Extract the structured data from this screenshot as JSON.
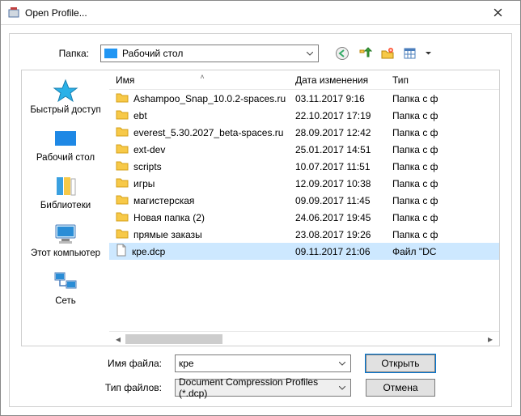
{
  "window": {
    "title": "Open Profile..."
  },
  "folder": {
    "label": "Папка:",
    "current": "Рабочий стол"
  },
  "sidebar": {
    "items": [
      {
        "label": "Быстрый доступ"
      },
      {
        "label": "Рабочий стол"
      },
      {
        "label": "Библиотеки"
      },
      {
        "label": "Этот компьютер"
      },
      {
        "label": "Сеть"
      }
    ]
  },
  "columns": {
    "name": "Имя",
    "date": "Дата изменения",
    "type": "Тип"
  },
  "files": [
    {
      "name": "Ashampoo_Snap_10.0.2-spaces.ru",
      "date": "03.11.2017 9:16",
      "type": "Папка с ф",
      "kind": "folder"
    },
    {
      "name": "ebt",
      "date": "22.10.2017 17:19",
      "type": "Папка с ф",
      "kind": "folder"
    },
    {
      "name": "everest_5.30.2027_beta-spaces.ru",
      "date": "28.09.2017 12:42",
      "type": "Папка с ф",
      "kind": "folder"
    },
    {
      "name": "ext-dev",
      "date": "25.01.2017 14:51",
      "type": "Папка с ф",
      "kind": "folder"
    },
    {
      "name": "scripts",
      "date": "10.07.2017 11:51",
      "type": "Папка с ф",
      "kind": "folder"
    },
    {
      "name": "игры",
      "date": "12.09.2017 10:38",
      "type": "Папка с ф",
      "kind": "folder"
    },
    {
      "name": "магистерская",
      "date": "09.09.2017 11:45",
      "type": "Папка с ф",
      "kind": "folder"
    },
    {
      "name": "Новая папка (2)",
      "date": "24.06.2017 19:45",
      "type": "Папка с ф",
      "kind": "folder"
    },
    {
      "name": "прямые заказы",
      "date": "23.08.2017 19:26",
      "type": "Папка с ф",
      "kind": "folder"
    },
    {
      "name": "кре.dcp",
      "date": "09.11.2017 21:06",
      "type": "Файл \"DC",
      "kind": "file",
      "selected": true
    }
  ],
  "footer": {
    "filename_label": "Имя файла:",
    "filename_value": "кре",
    "filetype_label": "Тип файлов:",
    "filetype_value": "Document Compression Profiles (*.dcp)",
    "open": "Открыть",
    "cancel": "Отмена"
  }
}
